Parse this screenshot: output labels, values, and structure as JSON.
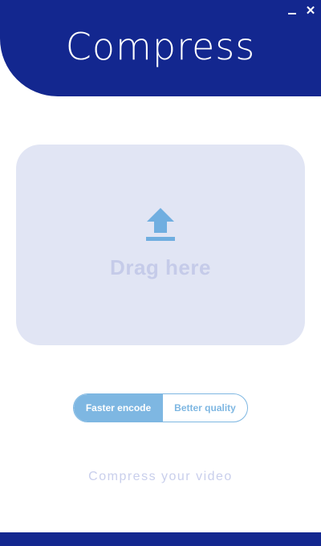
{
  "window": {
    "title": "Compress",
    "minimize_icon": "minimize-icon",
    "close_icon": "close-icon",
    "close_glyph": "✕"
  },
  "drop_zone": {
    "icon": "upload-icon",
    "label": "Drag here"
  },
  "encode_mode": {
    "options": [
      "Faster encode",
      "Better quality"
    ],
    "selected": "Faster encode"
  },
  "tagline": "Compress your video",
  "colors": {
    "header": "#13278f",
    "footer": "#13278f",
    "drop_zone_bg": "#e1e5f4",
    "drop_zone_text": "#c5cbe9",
    "accent": "#7eb7e2",
    "upload_icon": "#70aee0",
    "tagline": "#c9cfec"
  }
}
